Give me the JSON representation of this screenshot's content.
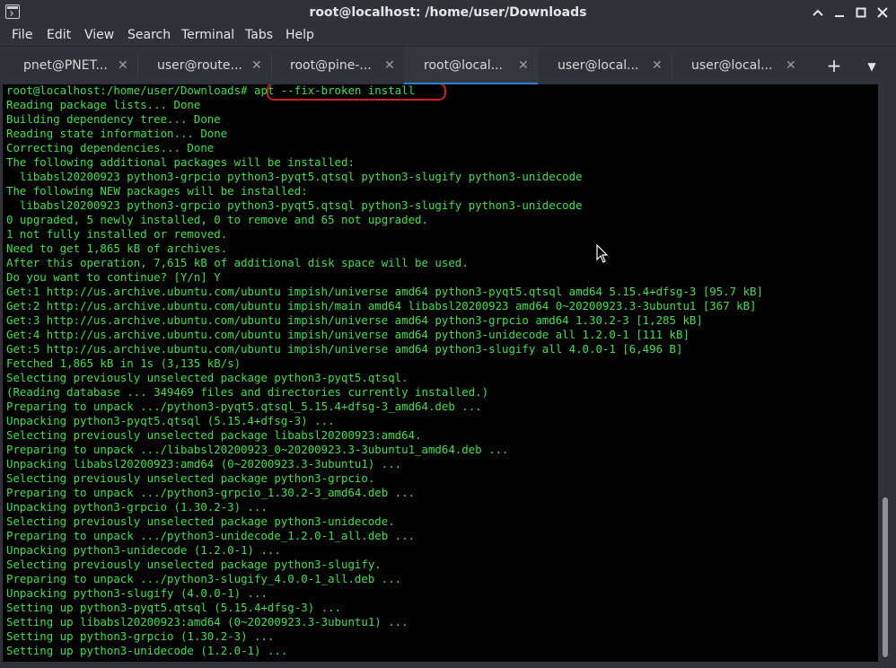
{
  "window": {
    "title": "root@localhost: /home/user/Downloads"
  },
  "menu": [
    "File",
    "Edit",
    "View",
    "Search",
    "Terminal",
    "Tabs",
    "Help"
  ],
  "tabs": [
    {
      "label": "pnet@PNET..."
    },
    {
      "label": "user@route..."
    },
    {
      "label": "root@pine-..."
    },
    {
      "label": "root@local..."
    },
    {
      "label": "user@local..."
    },
    {
      "label": "user@local..."
    }
  ],
  "active_tab": 3,
  "terminal": {
    "prompt": "root@localhost:/home/user/Downloads#",
    "command": " apt --fix-broken install",
    "lines": [
      "Reading package lists... Done",
      "Building dependency tree... Done",
      "Reading state information... Done",
      "Correcting dependencies... Done",
      "The following additional packages will be installed:",
      "  libabsl20200923 python3-grpcio python3-pyqt5.qtsql python3-slugify python3-unidecode",
      "The following NEW packages will be installed:",
      "  libabsl20200923 python3-grpcio python3-pyqt5.qtsql python3-slugify python3-unidecode",
      "0 upgraded, 5 newly installed, 0 to remove and 65 not upgraded.",
      "1 not fully installed or removed.",
      "Need to get 1,865 kB of archives.",
      "After this operation, 7,615 kB of additional disk space will be used.",
      "Do you want to continue? [Y/n] Y",
      "Get:1 http://us.archive.ubuntu.com/ubuntu impish/universe amd64 python3-pyqt5.qtsql amd64 5.15.4+dfsg-3 [95.7 kB]",
      "Get:2 http://us.archive.ubuntu.com/ubuntu impish/main amd64 libabsl20200923 amd64 0~20200923.3-3ubuntu1 [367 kB]",
      "Get:3 http://us.archive.ubuntu.com/ubuntu impish/universe amd64 python3-grpcio amd64 1.30.2-3 [1,285 kB]",
      "Get:4 http://us.archive.ubuntu.com/ubuntu impish/universe amd64 python3-unidecode all 1.2.0-1 [111 kB]",
      "Get:5 http://us.archive.ubuntu.com/ubuntu impish/universe amd64 python3-slugify all 4.0.0-1 [6,496 B]",
      "Fetched 1,865 kB in 1s (3,135 kB/s)",
      "Selecting previously unselected package python3-pyqt5.qtsql.",
      "(Reading database ... 349469 files and directories currently installed.)",
      "Preparing to unpack .../python3-pyqt5.qtsql_5.15.4+dfsg-3_amd64.deb ...",
      "Unpacking python3-pyqt5.qtsql (5.15.4+dfsg-3) ...",
      "Selecting previously unselected package libabsl20200923:amd64.",
      "Preparing to unpack .../libabsl20200923_0~20200923.3-3ubuntu1_amd64.deb ...",
      "Unpacking libabsl20200923:amd64 (0~20200923.3-3ubuntu1) ...",
      "Selecting previously unselected package python3-grpcio.",
      "Preparing to unpack .../python3-grpcio_1.30.2-3_amd64.deb ...",
      "Unpacking python3-grpcio (1.30.2-3) ...",
      "Selecting previously unselected package python3-unidecode.",
      "Preparing to unpack .../python3-unidecode_1.2.0-1_all.deb ...",
      "Unpacking python3-unidecode (1.2.0-1) ...",
      "Selecting previously unselected package python3-slugify.",
      "Preparing to unpack .../python3-slugify_4.0.0-1_all.deb ...",
      "Unpacking python3-slugify (4.0.0-1) ...",
      "Setting up python3-pyqt5.qtsql (5.15.4+dfsg-3) ...",
      "Setting up libabsl20200923:amd64 (0~20200923.3-3ubuntu1) ...",
      "Setting up python3-grpcio (1.30.2-3) ...",
      "Setting up python3-unidecode (1.2.0-1) ..."
    ]
  },
  "colors": {
    "terminal_bg": "#000000",
    "terminal_fg": "#3be14a",
    "highlight": "#d11e1e",
    "active_tab_accent": "#2f7fd1"
  },
  "icons": {
    "app": "terminal-icon",
    "minimize": "minimize-icon",
    "maximize": "maximize-icon",
    "close": "close-icon",
    "new_tab": "plus-icon",
    "tab_menu": "chevron-down-icon"
  }
}
